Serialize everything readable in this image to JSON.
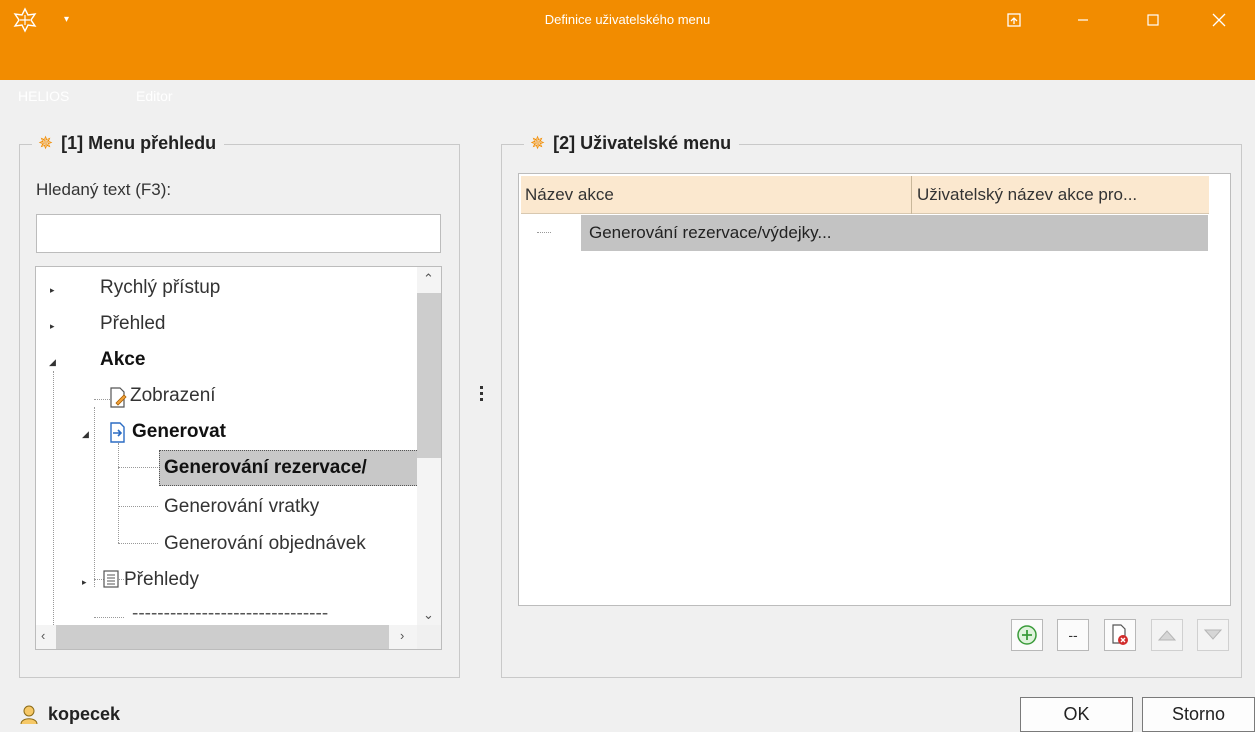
{
  "window": {
    "title": "Definice uživatelského menu",
    "colors": {
      "accent": "#f28c00",
      "title_text": "#ffffff"
    }
  },
  "menubar": {
    "items": [
      "HELIOS",
      "Editor"
    ]
  },
  "left_panel": {
    "title": "[1] Menu přehledu",
    "search_label": "Hledaný text (F3):",
    "search_value": "",
    "tree": {
      "rychly": "Rychlý přístup",
      "prehled": "Přehled",
      "akce": "Akce",
      "zobrazeni": "Zobrazení",
      "generovat": "Generovat",
      "gen_rezervace": "Generování rezervace/",
      "gen_vratky": "Generování vratky",
      "gen_objednavek": "Generování objednávek",
      "prehledy": "Přehledy",
      "separator": "-------------------------------"
    }
  },
  "right_panel": {
    "title": "[2] Uživatelské menu",
    "columns": [
      "Název akce",
      "Uživatelský název akce pro..."
    ],
    "rows": [
      {
        "name": "Generování rezervace/výdejky..."
      }
    ],
    "toolbar": {
      "add": "+",
      "remove": "--",
      "delete": "delete",
      "up": "up",
      "down": "down"
    }
  },
  "status": {
    "user": "kopecek"
  },
  "buttons": {
    "ok": "OK",
    "cancel": "Storno"
  }
}
